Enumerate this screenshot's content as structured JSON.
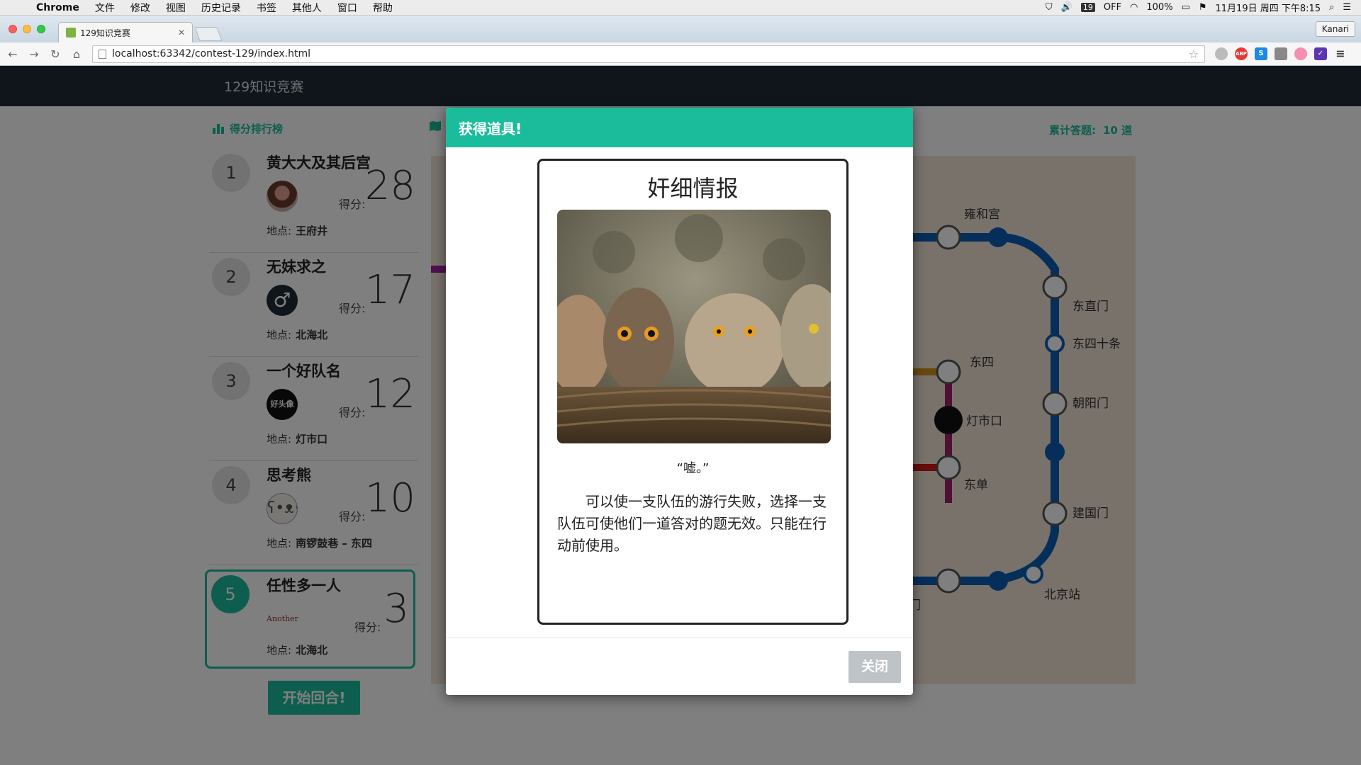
{
  "menubar": {
    "app": "Chrome",
    "items": [
      "文件",
      "修改",
      "视图",
      "历史记录",
      "书签",
      "其他人",
      "窗口",
      "帮助"
    ],
    "status": {
      "badge": "19",
      "toggle": "OFF",
      "battery": "100%",
      "datetime": "11月19日 周四 下午8:15"
    }
  },
  "browser": {
    "tab_title": "129知识竞赛",
    "url": "localhost:63342/contest-129/index.html",
    "profile": "Kanari",
    "extensions": [
      "ABP",
      "S"
    ]
  },
  "page": {
    "brand": "129知识竞赛",
    "leaderboard_title": "得分排行榜",
    "answered_label": "累计答题:",
    "answered_value": "10 道",
    "score_label": "得分:",
    "location_label": "地点:",
    "teams": [
      {
        "rank": "1",
        "name": "黄大大及其后宫",
        "score": "28",
        "location": "王府井"
      },
      {
        "rank": "2",
        "name": "无妹求之",
        "score": "17",
        "location": "北海北"
      },
      {
        "rank": "3",
        "name": "一个好队名",
        "score": "12",
        "location": "灯市口"
      },
      {
        "rank": "4",
        "name": "思考熊",
        "score": "10",
        "location": "南锣鼓巷 – 东四"
      },
      {
        "rank": "5",
        "name": "任性多一人",
        "score": "3",
        "location": "北海北"
      }
    ],
    "avatar_text": {
      "team3": "好头像",
      "team5": "Another"
    },
    "start_button": "开始回合!",
    "map_stations": [
      "雍和宫",
      "东直门",
      "东四十条",
      "东四",
      "朝阳门",
      "灯市口",
      "东单",
      "建国门",
      "北京站",
      "崇文门"
    ]
  },
  "modal": {
    "header": "获得道具!",
    "card_title": "奸细情报",
    "quote": "“嘘。”",
    "description": "可以使一支队伍的游行失败，选择一支队伍可使他们一道答对的题无效。只能在行动前使用。",
    "close_button": "关闭"
  },
  "colors": {
    "accent": "#1abc9c",
    "navbar": "#1e2a37",
    "metro_line": "#0a5fb4",
    "disabled_button": "#bdc3c7"
  }
}
